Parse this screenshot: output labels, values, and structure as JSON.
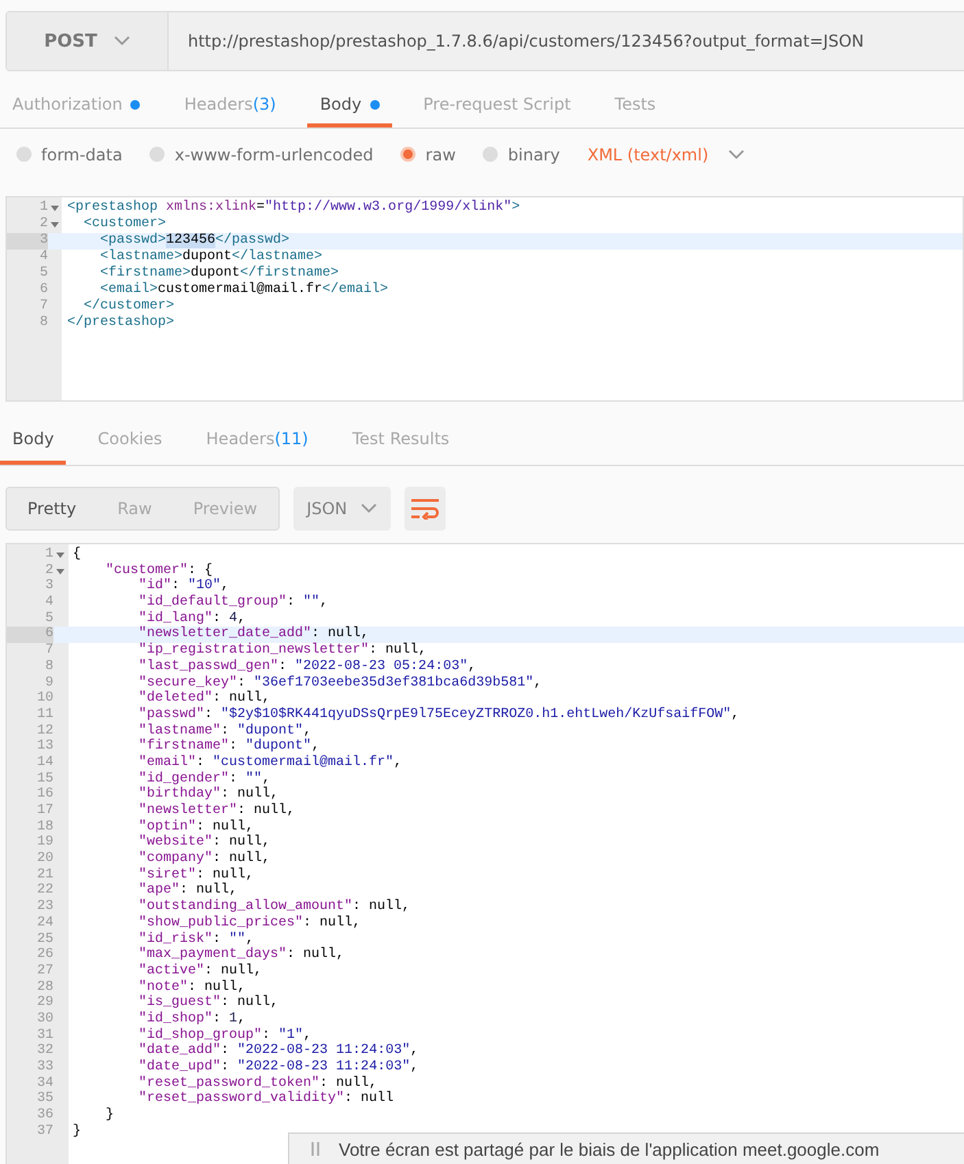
{
  "request": {
    "method": "POST",
    "url": "http://prestashop/prestashop_1.7.8.6/api/customers/123456?output_format=JSON"
  },
  "request_tabs": [
    {
      "label": "Authorization",
      "dot": true,
      "selected": false
    },
    {
      "label": "Headers",
      "count": "(3)",
      "dot": false,
      "selected": false
    },
    {
      "label": "Body",
      "dot": true,
      "selected": true
    },
    {
      "label": "Pre-request Script",
      "dot": false,
      "selected": false
    },
    {
      "label": "Tests",
      "dot": false,
      "selected": false
    }
  ],
  "body_types": [
    {
      "label": "form-data",
      "selected": false
    },
    {
      "label": "x-www-form-urlencoded",
      "selected": false
    },
    {
      "label": "raw",
      "selected": true
    },
    {
      "label": "binary",
      "selected": false
    }
  ],
  "body_format": "XML (text/xml)",
  "request_editor": {
    "lines": [
      {
        "number": "1",
        "foldable": true,
        "highlighted": false,
        "tokens": [
          {
            "kind": "tag",
            "text": "<prestashop"
          },
          {
            "kind": "attr",
            "text": " xmlns:xlink"
          },
          {
            "kind": "text",
            "text": "="
          },
          {
            "kind": "string",
            "text": "\"http://www.w3.org/1999/xlink\""
          },
          {
            "kind": "tag",
            "text": ">"
          }
        ]
      },
      {
        "number": "2",
        "foldable": true,
        "highlighted": false,
        "tokens": [
          {
            "kind": "tag",
            "text": "  <customer>"
          }
        ]
      },
      {
        "number": "3",
        "foldable": false,
        "highlighted": true,
        "tokens": [
          {
            "kind": "tag",
            "text": "    <passwd>"
          },
          {
            "kind": "text",
            "text": "123456",
            "selected": true
          },
          {
            "kind": "tag",
            "text": "</passwd>"
          }
        ]
      },
      {
        "number": "4",
        "foldable": false,
        "highlighted": false,
        "tokens": [
          {
            "kind": "tag",
            "text": "    <lastname>"
          },
          {
            "kind": "text",
            "text": "dupont"
          },
          {
            "kind": "tag",
            "text": "</lastname>"
          }
        ]
      },
      {
        "number": "5",
        "foldable": false,
        "highlighted": false,
        "tokens": [
          {
            "kind": "tag",
            "text": "    <firstname>"
          },
          {
            "kind": "text",
            "text": "dupont"
          },
          {
            "kind": "tag",
            "text": "</firstname>"
          }
        ]
      },
      {
        "number": "6",
        "foldable": false,
        "highlighted": false,
        "tokens": [
          {
            "kind": "tag",
            "text": "    <email>"
          },
          {
            "kind": "text",
            "text": "customermail@mail.fr"
          },
          {
            "kind": "tag",
            "text": "</email>"
          }
        ]
      },
      {
        "number": "7",
        "foldable": false,
        "highlighted": false,
        "tokens": [
          {
            "kind": "tag",
            "text": "  </customer>"
          }
        ]
      },
      {
        "number": "8",
        "foldable": false,
        "highlighted": false,
        "tokens": [
          {
            "kind": "tag",
            "text": "</prestashop>"
          }
        ]
      }
    ]
  },
  "response_tabs": [
    {
      "label": "Body",
      "selected": true
    },
    {
      "label": "Cookies",
      "selected": false
    },
    {
      "label": "Headers",
      "count": "(11)",
      "selected": false
    },
    {
      "label": "Test Results",
      "selected": false
    }
  ],
  "view_modes": [
    {
      "label": "Pretty",
      "selected": true
    },
    {
      "label": "Raw",
      "selected": false
    },
    {
      "label": "Preview",
      "selected": false
    }
  ],
  "response_format": "JSON",
  "response_editor": {
    "lines": [
      {
        "number": "1",
        "foldable": true,
        "highlighted": false,
        "tokens": [
          {
            "kind": "punct",
            "text": "{"
          }
        ]
      },
      {
        "number": "2",
        "foldable": true,
        "highlighted": false,
        "tokens": [
          {
            "kind": "key",
            "text": "    \"customer\""
          },
          {
            "kind": "punct",
            "text": ": {"
          }
        ]
      },
      {
        "number": "3",
        "foldable": false,
        "highlighted": false,
        "tokens": [
          {
            "kind": "key",
            "text": "        \"id\""
          },
          {
            "kind": "punct",
            "text": ": "
          },
          {
            "kind": "string",
            "text": "\"10\""
          },
          {
            "kind": "punct",
            "text": ","
          }
        ]
      },
      {
        "number": "4",
        "foldable": false,
        "highlighted": false,
        "tokens": [
          {
            "kind": "key",
            "text": "        \"id_default_group\""
          },
          {
            "kind": "punct",
            "text": ": "
          },
          {
            "kind": "string",
            "text": "\"\""
          },
          {
            "kind": "punct",
            "text": ","
          }
        ]
      },
      {
        "number": "5",
        "foldable": false,
        "highlighted": false,
        "tokens": [
          {
            "kind": "key",
            "text": "        \"id_lang\""
          },
          {
            "kind": "punct",
            "text": ": "
          },
          {
            "kind": "number",
            "text": "4"
          },
          {
            "kind": "punct",
            "text": ","
          }
        ]
      },
      {
        "number": "6",
        "foldable": false,
        "highlighted": true,
        "tokens": [
          {
            "kind": "key",
            "text": "        \"newsletter_date_add\""
          },
          {
            "kind": "punct",
            "text": ": null,"
          }
        ]
      },
      {
        "number": "7",
        "foldable": false,
        "highlighted": false,
        "tokens": [
          {
            "kind": "key",
            "text": "        \"ip_registration_newsletter\""
          },
          {
            "kind": "punct",
            "text": ": null,"
          }
        ]
      },
      {
        "number": "8",
        "foldable": false,
        "highlighted": false,
        "tokens": [
          {
            "kind": "key",
            "text": "        \"last_passwd_gen\""
          },
          {
            "kind": "punct",
            "text": ": "
          },
          {
            "kind": "string",
            "text": "\"2022-08-23 05:24:03\""
          },
          {
            "kind": "punct",
            "text": ","
          }
        ]
      },
      {
        "number": "9",
        "foldable": false,
        "highlighted": false,
        "tokens": [
          {
            "kind": "key",
            "text": "        \"secure_key\""
          },
          {
            "kind": "punct",
            "text": ": "
          },
          {
            "kind": "string",
            "text": "\"36ef1703eebe35d3ef381bca6d39b581\""
          },
          {
            "kind": "punct",
            "text": ","
          }
        ]
      },
      {
        "number": "10",
        "foldable": false,
        "highlighted": false,
        "tokens": [
          {
            "kind": "key",
            "text": "        \"deleted\""
          },
          {
            "kind": "punct",
            "text": ": null,"
          }
        ]
      },
      {
        "number": "11",
        "foldable": false,
        "highlighted": false,
        "tokens": [
          {
            "kind": "key",
            "text": "        \"passwd\""
          },
          {
            "kind": "punct",
            "text": ": "
          },
          {
            "kind": "string",
            "text": "\"$2y$10$RK441qyuDSsQrpE9l75EceyZTRROZ0.h1.ehtLweh/KzUfsaifFOW\""
          },
          {
            "kind": "punct",
            "text": ","
          }
        ]
      },
      {
        "number": "12",
        "foldable": false,
        "highlighted": false,
        "tokens": [
          {
            "kind": "key",
            "text": "        \"lastname\""
          },
          {
            "kind": "punct",
            "text": ": "
          },
          {
            "kind": "string",
            "text": "\"dupont\""
          },
          {
            "kind": "punct",
            "text": ","
          }
        ]
      },
      {
        "number": "13",
        "foldable": false,
        "highlighted": false,
        "tokens": [
          {
            "kind": "key",
            "text": "        \"firstname\""
          },
          {
            "kind": "punct",
            "text": ": "
          },
          {
            "kind": "string",
            "text": "\"dupont\""
          },
          {
            "kind": "punct",
            "text": ","
          }
        ]
      },
      {
        "number": "14",
        "foldable": false,
        "highlighted": false,
        "tokens": [
          {
            "kind": "key",
            "text": "        \"email\""
          },
          {
            "kind": "punct",
            "text": ": "
          },
          {
            "kind": "string",
            "text": "\"customermail@mail.fr\""
          },
          {
            "kind": "punct",
            "text": ","
          }
        ]
      },
      {
        "number": "15",
        "foldable": false,
        "highlighted": false,
        "tokens": [
          {
            "kind": "key",
            "text": "        \"id_gender\""
          },
          {
            "kind": "punct",
            "text": ": "
          },
          {
            "kind": "string",
            "text": "\"\""
          },
          {
            "kind": "punct",
            "text": ","
          }
        ]
      },
      {
        "number": "16",
        "foldable": false,
        "highlighted": false,
        "tokens": [
          {
            "kind": "key",
            "text": "        \"birthday\""
          },
          {
            "kind": "punct",
            "text": ": null,"
          }
        ]
      },
      {
        "number": "17",
        "foldable": false,
        "highlighted": false,
        "tokens": [
          {
            "kind": "key",
            "text": "        \"newsletter\""
          },
          {
            "kind": "punct",
            "text": ": null,"
          }
        ]
      },
      {
        "number": "18",
        "foldable": false,
        "highlighted": false,
        "tokens": [
          {
            "kind": "key",
            "text": "        \"optin\""
          },
          {
            "kind": "punct",
            "text": ": null,"
          }
        ]
      },
      {
        "number": "19",
        "foldable": false,
        "highlighted": false,
        "tokens": [
          {
            "kind": "key",
            "text": "        \"website\""
          },
          {
            "kind": "punct",
            "text": ": null,"
          }
        ]
      },
      {
        "number": "20",
        "foldable": false,
        "highlighted": false,
        "tokens": [
          {
            "kind": "key",
            "text": "        \"company\""
          },
          {
            "kind": "punct",
            "text": ": null,"
          }
        ]
      },
      {
        "number": "21",
        "foldable": false,
        "highlighted": false,
        "tokens": [
          {
            "kind": "key",
            "text": "        \"siret\""
          },
          {
            "kind": "punct",
            "text": ": null,"
          }
        ]
      },
      {
        "number": "22",
        "foldable": false,
        "highlighted": false,
        "tokens": [
          {
            "kind": "key",
            "text": "        \"ape\""
          },
          {
            "kind": "punct",
            "text": ": null,"
          }
        ]
      },
      {
        "number": "23",
        "foldable": false,
        "highlighted": false,
        "tokens": [
          {
            "kind": "key",
            "text": "        \"outstanding_allow_amount\""
          },
          {
            "kind": "punct",
            "text": ": null,"
          }
        ]
      },
      {
        "number": "24",
        "foldable": false,
        "highlighted": false,
        "tokens": [
          {
            "kind": "key",
            "text": "        \"show_public_prices\""
          },
          {
            "kind": "punct",
            "text": ": null,"
          }
        ]
      },
      {
        "number": "25",
        "foldable": false,
        "highlighted": false,
        "tokens": [
          {
            "kind": "key",
            "text": "        \"id_risk\""
          },
          {
            "kind": "punct",
            "text": ": "
          },
          {
            "kind": "string",
            "text": "\"\""
          },
          {
            "kind": "punct",
            "text": ","
          }
        ]
      },
      {
        "number": "26",
        "foldable": false,
        "highlighted": false,
        "tokens": [
          {
            "kind": "key",
            "text": "        \"max_payment_days\""
          },
          {
            "kind": "punct",
            "text": ": null,"
          }
        ]
      },
      {
        "number": "27",
        "foldable": false,
        "highlighted": false,
        "tokens": [
          {
            "kind": "key",
            "text": "        \"active\""
          },
          {
            "kind": "punct",
            "text": ": null,"
          }
        ]
      },
      {
        "number": "28",
        "foldable": false,
        "highlighted": false,
        "tokens": [
          {
            "kind": "key",
            "text": "        \"note\""
          },
          {
            "kind": "punct",
            "text": ": null,"
          }
        ]
      },
      {
        "number": "29",
        "foldable": false,
        "highlighted": false,
        "tokens": [
          {
            "kind": "key",
            "text": "        \"is_guest\""
          },
          {
            "kind": "punct",
            "text": ": null,"
          }
        ]
      },
      {
        "number": "30",
        "foldable": false,
        "highlighted": false,
        "tokens": [
          {
            "kind": "key",
            "text": "        \"id_shop\""
          },
          {
            "kind": "punct",
            "text": ": "
          },
          {
            "kind": "number",
            "text": "1"
          },
          {
            "kind": "punct",
            "text": ","
          }
        ]
      },
      {
        "number": "31",
        "foldable": false,
        "highlighted": false,
        "tokens": [
          {
            "kind": "key",
            "text": "        \"id_shop_group\""
          },
          {
            "kind": "punct",
            "text": ": "
          },
          {
            "kind": "string",
            "text": "\"1\""
          },
          {
            "kind": "punct",
            "text": ","
          }
        ]
      },
      {
        "number": "32",
        "foldable": false,
        "highlighted": false,
        "tokens": [
          {
            "kind": "key",
            "text": "        \"date_add\""
          },
          {
            "kind": "punct",
            "text": ": "
          },
          {
            "kind": "string",
            "text": "\"2022-08-23 11:24:03\""
          },
          {
            "kind": "punct",
            "text": ","
          }
        ]
      },
      {
        "number": "33",
        "foldable": false,
        "highlighted": false,
        "tokens": [
          {
            "kind": "key",
            "text": "        \"date_upd\""
          },
          {
            "kind": "punct",
            "text": ": "
          },
          {
            "kind": "string",
            "text": "\"2022-08-23 11:24:03\""
          },
          {
            "kind": "punct",
            "text": ","
          }
        ]
      },
      {
        "number": "34",
        "foldable": false,
        "highlighted": false,
        "tokens": [
          {
            "kind": "key",
            "text": "        \"reset_password_token\""
          },
          {
            "kind": "punct",
            "text": ": null,"
          }
        ]
      },
      {
        "number": "35",
        "foldable": false,
        "highlighted": false,
        "tokens": [
          {
            "kind": "key",
            "text": "        \"reset_password_validity\""
          },
          {
            "kind": "punct",
            "text": ": null"
          }
        ]
      },
      {
        "number": "36",
        "foldable": false,
        "highlighted": false,
        "tokens": [
          {
            "kind": "punct",
            "text": "    }"
          }
        ]
      },
      {
        "number": "37",
        "foldable": false,
        "highlighted": false,
        "tokens": [
          {
            "kind": "punct",
            "text": "}"
          }
        ]
      }
    ]
  },
  "share_banner": {
    "text": "Votre écran est partagé par le biais de l'application meet.google.com"
  }
}
